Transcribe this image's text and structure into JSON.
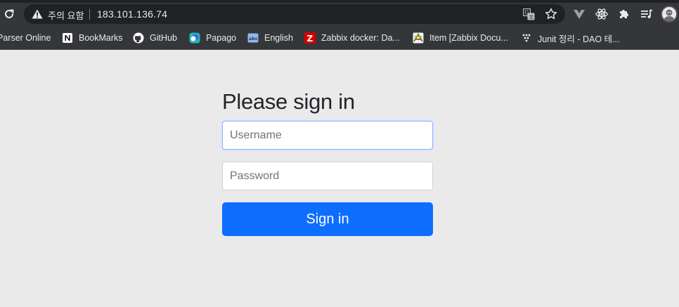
{
  "browser": {
    "security_text": "주의 요함",
    "url": "183.101.136.74"
  },
  "bookmarks": [
    {
      "label": "Parser Online",
      "icon": "none"
    },
    {
      "label": "BookMarks",
      "icon": "notion-icon"
    },
    {
      "label": "GitHub",
      "icon": "github-icon"
    },
    {
      "label": "Papago",
      "icon": "papago-icon"
    },
    {
      "label": "English",
      "icon": "abc-icon"
    },
    {
      "label": "Zabbix docker: Da...",
      "icon": "zabbix-icon"
    },
    {
      "label": "Item [Zabbix Docu...",
      "icon": "zabbix-doc-icon"
    },
    {
      "label": "Junit 정리 - DAO 테...",
      "icon": "dots-icon"
    }
  ],
  "signin": {
    "heading": "Please sign in",
    "username_placeholder": "Username",
    "password_placeholder": "Password",
    "button_label": "Sign in"
  },
  "colors": {
    "chrome_bar": "#35363a",
    "omnibox": "#202124",
    "page_bg": "#eaeaea",
    "button": "#0d6efd",
    "focus_border": "#86b7fe"
  }
}
